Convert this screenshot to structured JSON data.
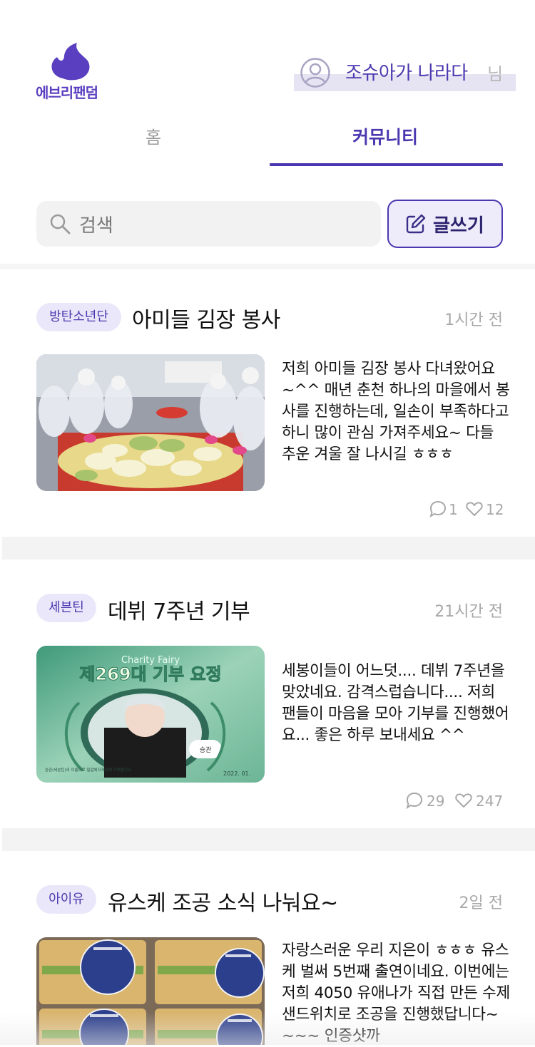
{
  "header": {
    "logo_text": "에브리팬덤",
    "user_name": "조슈아가 나라다",
    "user_suffix": "님"
  },
  "tabs": [
    {
      "label": "홈",
      "active": false
    },
    {
      "label": "커뮤니티",
      "active": true
    }
  ],
  "search": {
    "placeholder": "검색"
  },
  "write_button": {
    "label": "글쓰기"
  },
  "posts": [
    {
      "tag": "방탄소년단",
      "title": "아미들 김장 봉사",
      "time": "1시간 전",
      "body": "저희 아미들 김장 봉사 다녀왔어요 ~^^ 매년 춘천 하나의 마을에서 봉사를 진행하는데, 일손이 부족하다고 하니 많이 관심 가져주세요~ 다들 추운 겨울 잘 나시길 ㅎㅎㅎ",
      "comments": "1",
      "likes": "12"
    },
    {
      "tag": "세븐틴",
      "title": "데뷔 7주년 기부",
      "time": "21시간 전",
      "body": "세봉이들이 어느덧.... 데뷔 7주년을 맞았네요. 감격스럽습니다.... 저희 팬들이 마음을 모아 기부를 진행했어요... 좋은 하루 보내세요 ^^",
      "image_title_top": "Charity Fairy",
      "image_title": "제269대 기부 요정",
      "image_name_tag": "승관",
      "image_date": "2022. 01.",
      "image_caption": "승관(세븐틴)의 이름으로\n밀알복지재단에 기부합니다",
      "comments": "29",
      "likes": "247"
    },
    {
      "tag": "아이유",
      "title": "유스케 조공 소식 나눠요~",
      "time": "2일 전",
      "body": "자랑스러운 우리 지은이 ㅎㅎㅎ 유스케 벌써 5번째 출연이네요. 이번에는 저희 4050 유애나가 직접 만든 수제 샌드위치로 조공을 진행했답니다~~~~ 인증샷까"
    }
  ],
  "colors": {
    "accent": "#4b38b0",
    "badge_bg": "#ebe7fa",
    "muted": "#a8a8a8"
  }
}
